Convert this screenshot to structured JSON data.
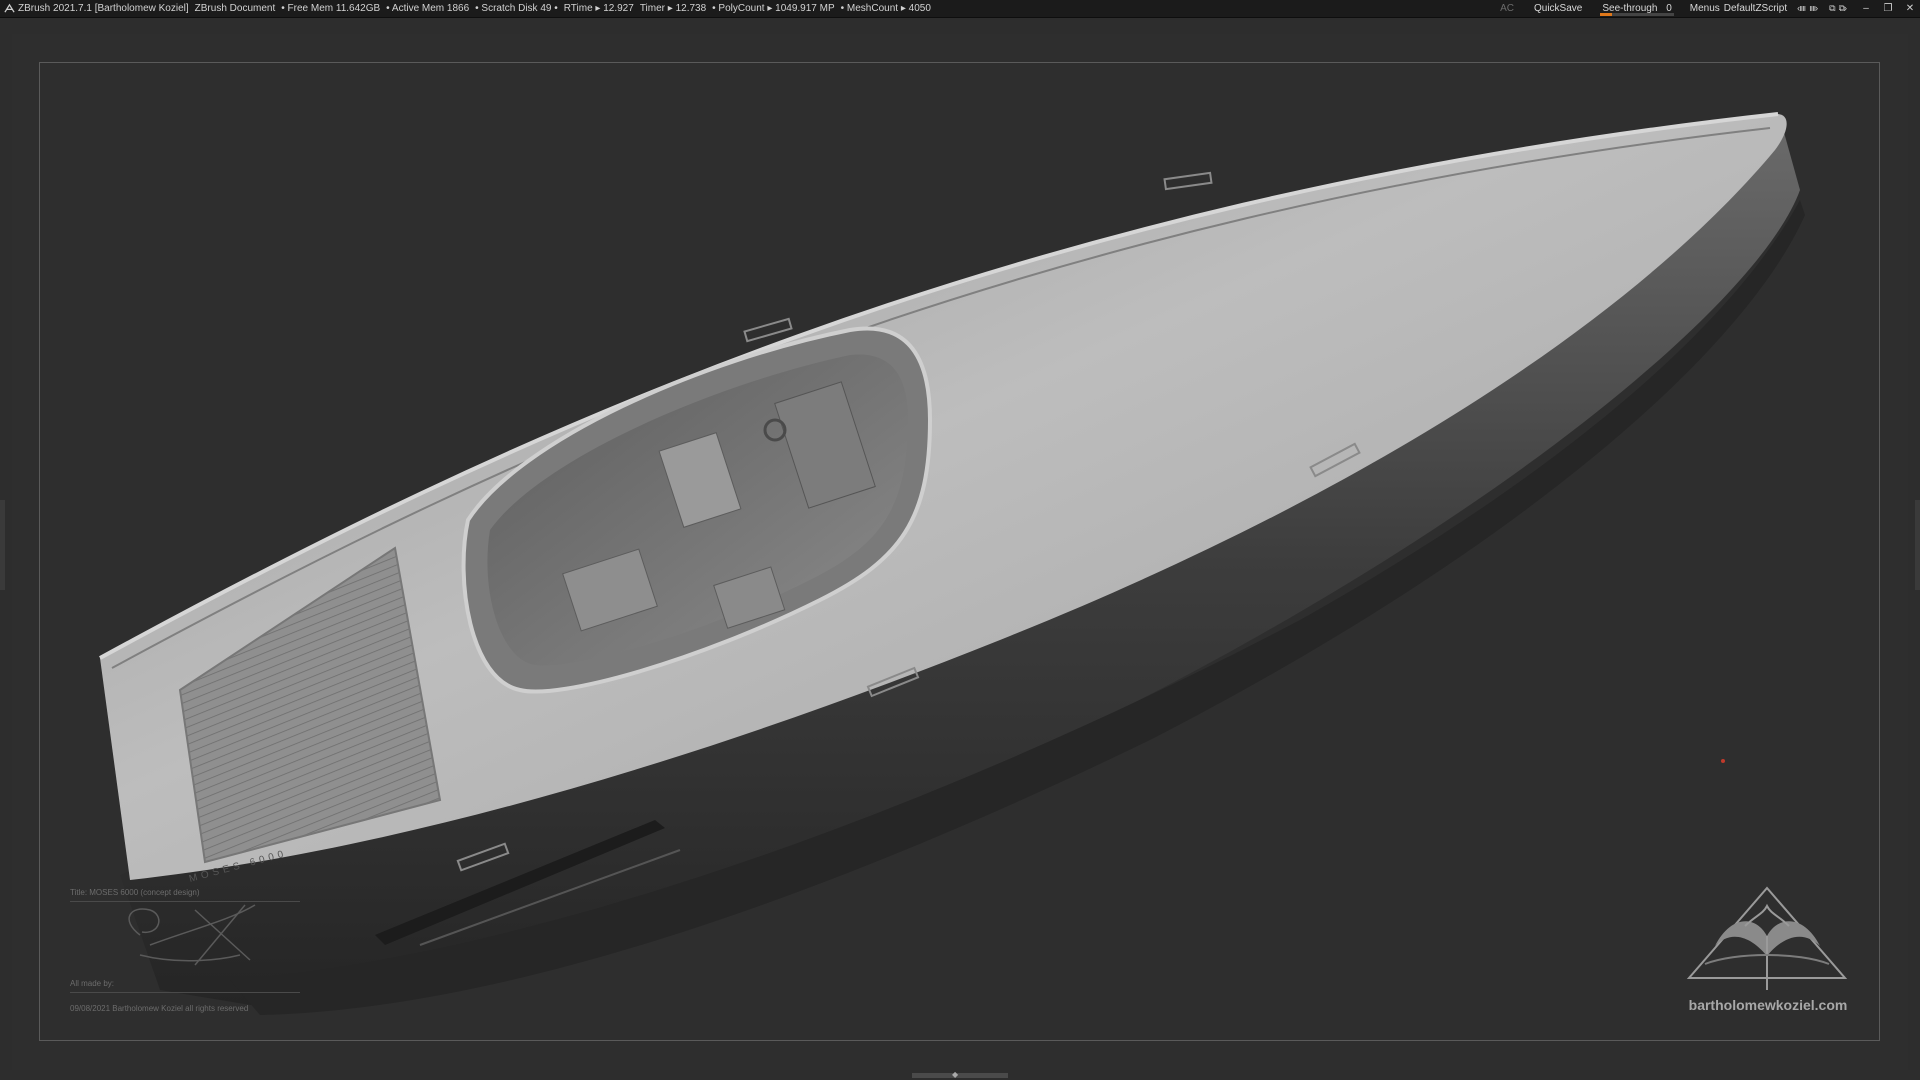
{
  "titlebar": {
    "app": "ZBrush 2021.7.1 [Bartholomew Koziel]",
    "document": "ZBrush Document",
    "free_mem": "• Free Mem 11.642GB",
    "active_mem": "• Active Mem 1866",
    "scratch_disk": "• Scratch Disk 49 •",
    "rtime": "RTime ▸ 12.927",
    "timer": "Timer ▸ 12.738",
    "polycount": "• PolyCount ▸ 1049.917 MP",
    "meshcount": "• MeshCount ▸ 4050"
  },
  "toolbar": {
    "ac": "AC",
    "quicksave": "QuickSave",
    "see_through_label": "See-through",
    "see_through_value": "0",
    "menus": "Menus",
    "default_zscript": "DefaultZScript"
  },
  "canvas": {
    "hull_name": "MOSES 6000",
    "title": "Title: MOSES 6000 (concept design)",
    "made_by": "All made by:",
    "copyright": "09/08/2021 Bartholomew Koziel all rights reserved",
    "brand_url": "bartholomewkoziel.com"
  },
  "colors": {
    "bg": "#2d2d2d",
    "topbar": "#1b1b1b",
    "accent": "#e0781a",
    "hull_light": "#b9b9b9",
    "hull_dark": "#3a3a3a"
  },
  "icons": [
    "zbrush-logo-icon",
    "window-minimize-icon",
    "window-restore-icon",
    "window-close-icon"
  ]
}
